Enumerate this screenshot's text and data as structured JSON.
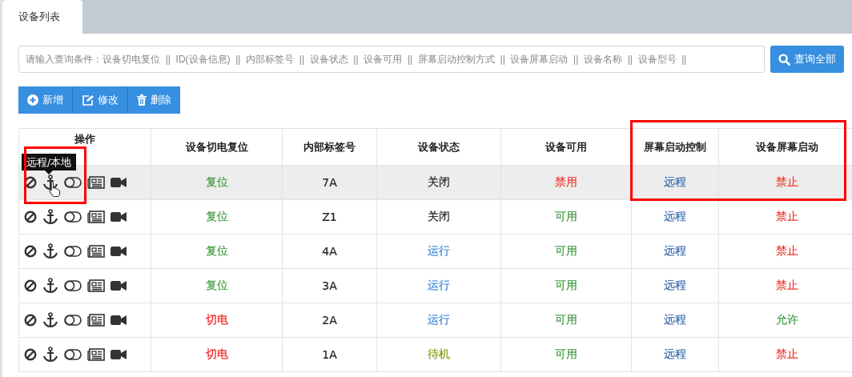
{
  "tabs": [
    {
      "label": "设备列表",
      "selected": true
    }
  ],
  "search": {
    "placeholder": "请输入查询条件：设备切电复位  ||  ID(设备信息)  ||  内部标签号  ||  设备状态  ||  设备可用  ||  屏幕启动控制方式  ||  设备屏幕启动  ||  设备名称  ||  设备型号  ||",
    "button": "查询全部"
  },
  "toolbar": [
    {
      "kind": "add",
      "label": "新增"
    },
    {
      "kind": "edit",
      "label": "修改"
    },
    {
      "kind": "delete",
      "label": "删除"
    }
  ],
  "table": {
    "columns": [
      "操作",
      "设备切电复位",
      "内部标签号",
      "设备状态",
      "设备可用",
      "屏幕启动控制",
      "设备屏幕启动"
    ],
    "rows": [
      {
        "hovered": true,
        "cells": [
          {
            "kind": "actions"
          },
          {
            "text": "复位",
            "color": "#3f9a3f"
          },
          {
            "text": "7A",
            "color": "#222222"
          },
          {
            "text": "关闭",
            "color": "#222222"
          },
          {
            "text": "禁用",
            "color": "#ee3b30"
          },
          {
            "text": "远程",
            "color": "#3d6db0"
          },
          {
            "text": "禁止",
            "color": "#ee3b30"
          }
        ]
      },
      {
        "hovered": false,
        "cells": [
          {
            "kind": "actions"
          },
          {
            "text": "复位",
            "color": "#3f9a3f"
          },
          {
            "text": "Z1",
            "color": "#222222"
          },
          {
            "text": "关闭",
            "color": "#222222"
          },
          {
            "text": "可用",
            "color": "#3f9a3f"
          },
          {
            "text": "远程",
            "color": "#3d6db0"
          },
          {
            "text": "禁止",
            "color": "#ee3b30"
          }
        ]
      },
      {
        "hovered": false,
        "cells": [
          {
            "kind": "actions"
          },
          {
            "text": "复位",
            "color": "#3f9a3f"
          },
          {
            "text": "4A",
            "color": "#222222"
          },
          {
            "text": "运行",
            "color": "#3f86d8"
          },
          {
            "text": "可用",
            "color": "#3f9a3f"
          },
          {
            "text": "远程",
            "color": "#3d6db0"
          },
          {
            "text": "禁止",
            "color": "#ee3b30"
          }
        ]
      },
      {
        "hovered": false,
        "cells": [
          {
            "kind": "actions"
          },
          {
            "text": "复位",
            "color": "#3f9a3f"
          },
          {
            "text": "3A",
            "color": "#222222"
          },
          {
            "text": "运行",
            "color": "#3f86d8"
          },
          {
            "text": "可用",
            "color": "#3f9a3f"
          },
          {
            "text": "远程",
            "color": "#3d6db0"
          },
          {
            "text": "禁止",
            "color": "#ee3b30"
          }
        ]
      },
      {
        "hovered": false,
        "cells": [
          {
            "kind": "actions"
          },
          {
            "text": "切电",
            "color": "#ee2020"
          },
          {
            "text": "2A",
            "color": "#222222"
          },
          {
            "text": "运行",
            "color": "#3f86d8"
          },
          {
            "text": "可用",
            "color": "#3f9a3f"
          },
          {
            "text": "远程",
            "color": "#3d6db0"
          },
          {
            "text": "允许",
            "color": "#3f9a3f"
          }
        ]
      },
      {
        "hovered": false,
        "cells": [
          {
            "kind": "actions"
          },
          {
            "text": "切电",
            "color": "#ee2020"
          },
          {
            "text": "1A",
            "color": "#222222"
          },
          {
            "text": "待机",
            "color": "#8a9a10"
          },
          {
            "text": "可用",
            "color": "#3f9a3f"
          },
          {
            "text": "远程",
            "color": "#3d6db0"
          },
          {
            "text": "禁止",
            "color": "#ee3b30"
          }
        ]
      }
    ]
  },
  "tooltip": {
    "text": "远程/本地"
  }
}
